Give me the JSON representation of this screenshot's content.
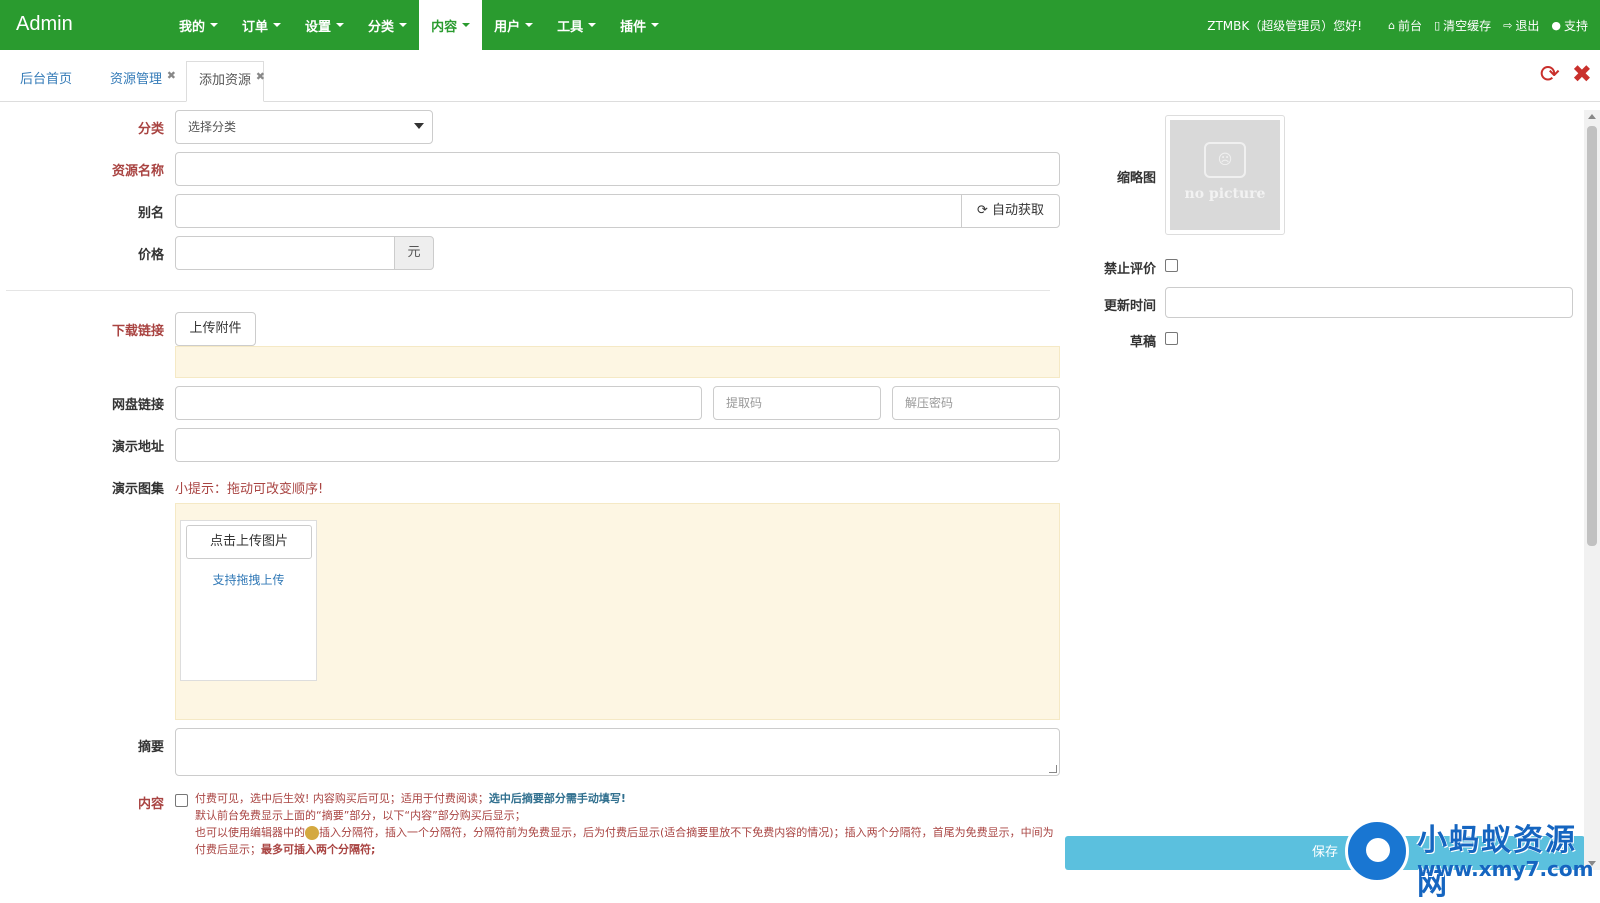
{
  "app": {
    "brand": "Admin"
  },
  "nav": [
    {
      "label": "我的"
    },
    {
      "label": "订单"
    },
    {
      "label": "设置"
    },
    {
      "label": "分类"
    },
    {
      "label": "内容"
    },
    {
      "label": "用户"
    },
    {
      "label": "工具"
    },
    {
      "label": "插件"
    }
  ],
  "user": {
    "greeting": "ZTMBK（超级管理员）您好!"
  },
  "userlinks": {
    "home": "前台",
    "clear": "清空缓存",
    "logout": "退出",
    "support": "支持"
  },
  "tabs": {
    "home": "后台首页",
    "manage": "资源管理",
    "add": "添加资源"
  },
  "form": {
    "category_label": "分类",
    "category_value": "选择分类",
    "name_label": "资源名称",
    "alias_label": "别名",
    "auto_btn": "自动获取",
    "price_label": "价格",
    "price_unit": "元",
    "download_label": "下载链接",
    "upload_btn": "上传附件",
    "pan_label": "网盘链接",
    "extract_placeholder": "提取码",
    "unzip_placeholder": "解压密码",
    "demo_label": "演示地址",
    "gallery_label": "演示图集",
    "gallery_tip": "小提示：拖动可改变顺序!",
    "gallery_upload": "点击上传图片",
    "gallery_drag": "支持拖拽上传",
    "summary_label": "摘要",
    "content_label": "内容",
    "note1": "付费可见，选中后生效! 内容购买后可见；适用于付费阅读；",
    "note1_bold": "选中后摘要部分需手动填写!",
    "note2": "默认前台免费显示上面的“摘要”部分，以下“内容”部分购买后显示；",
    "note3a": "也可以使用编辑器中的",
    "note3b": "插入分隔符，插入一个分隔符，分隔符前为免费显示，后为付费后显示(适合摘要里放不下免费内容的情况)；插入两个分隔符，首尾为免费显示，中间为付费后显示；",
    "note3_bold": "最多可插入两个分隔符;"
  },
  "side": {
    "thumb_label": "缩略图",
    "thumb_text": "no picture",
    "no_comment_label": "禁止评价",
    "update_time_label": "更新时间",
    "draft_label": "草稿",
    "save_btn": "保存"
  },
  "watermark": {
    "title": "小蚂蚁资源网",
    "url": "www.xmy7.com"
  },
  "colors": {
    "navbar": "#2a9b2f",
    "required_label": "#a94442",
    "cream": "#fdf6e3",
    "save": "#5bc0de"
  }
}
